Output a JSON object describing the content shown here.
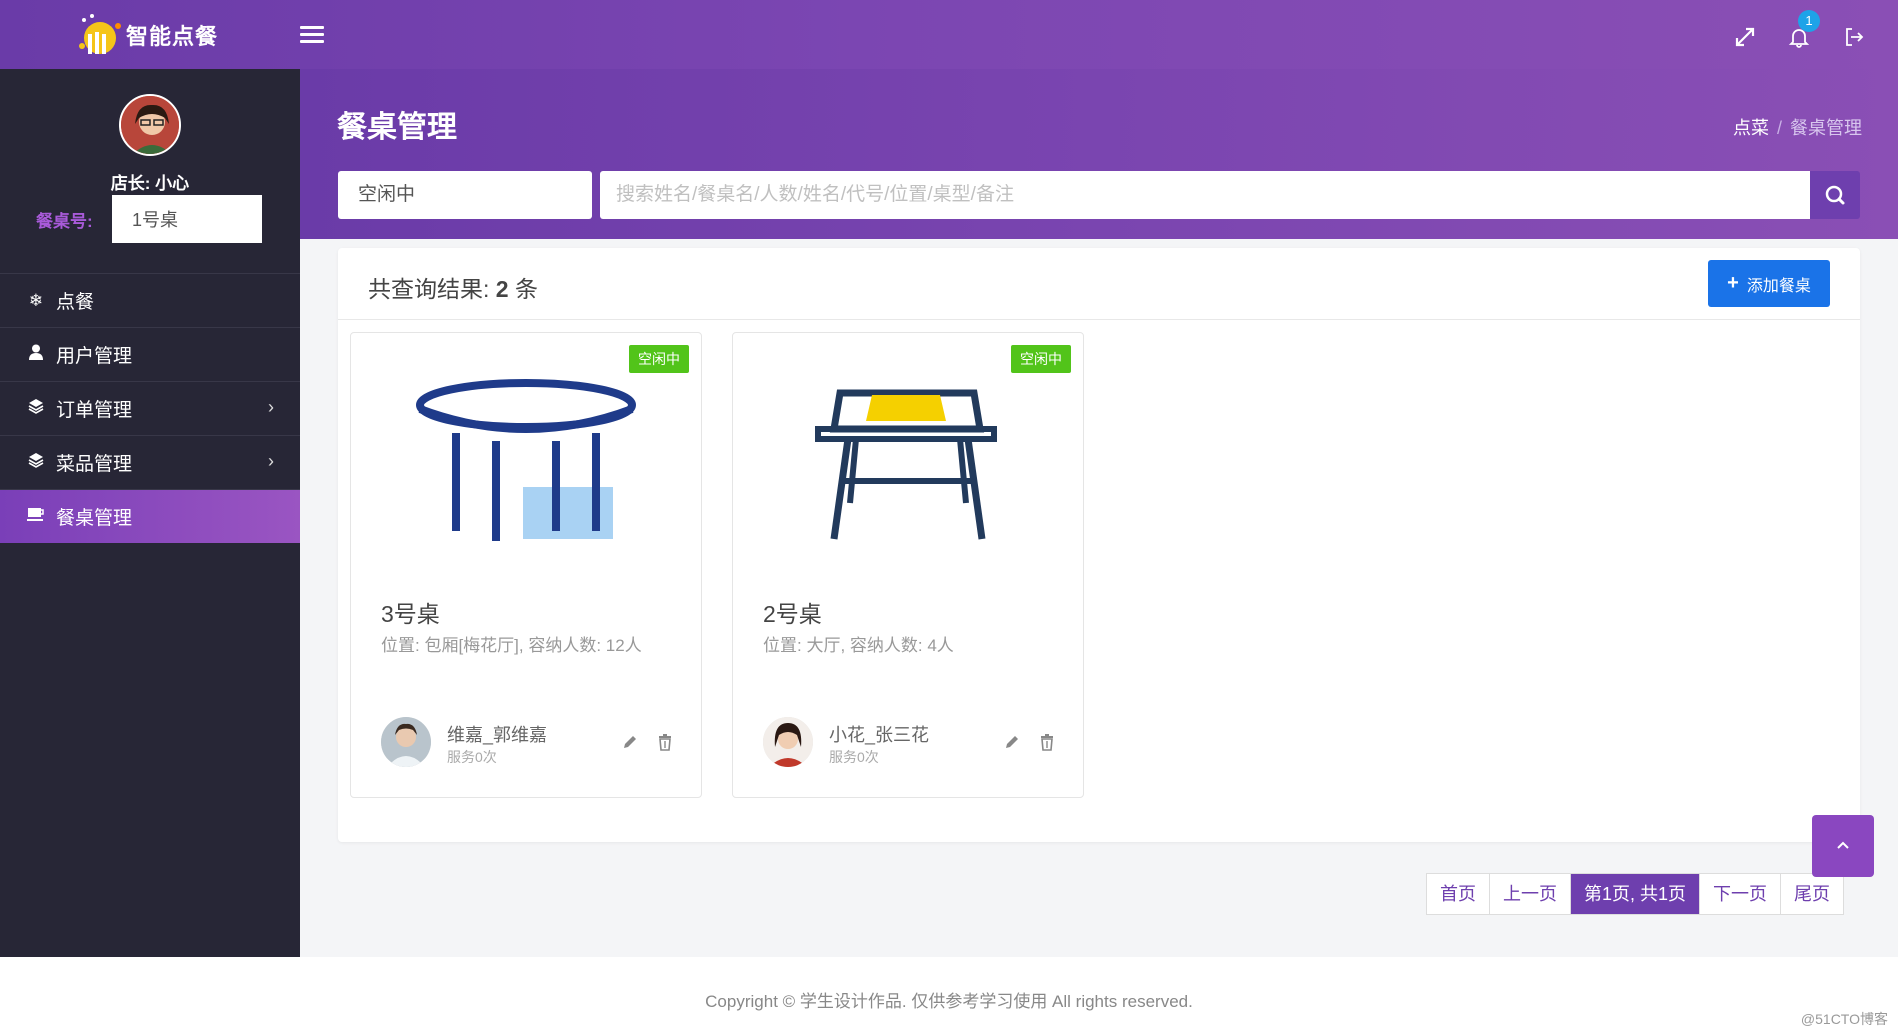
{
  "app": {
    "logo_text": "智能点餐"
  },
  "topbar": {
    "notification_count": "1"
  },
  "sidebar": {
    "owner_label": "店长: 小心",
    "table_no_label": "餐桌号:",
    "table_no_value": "1号桌",
    "items": [
      {
        "label": "点餐",
        "icon": "snowflake-icon",
        "has_submenu": false,
        "active": false
      },
      {
        "label": "用户管理",
        "icon": "user-icon",
        "has_submenu": false,
        "active": false
      },
      {
        "label": "订单管理",
        "icon": "layers-icon",
        "has_submenu": true,
        "active": false
      },
      {
        "label": "菜品管理",
        "icon": "layers-icon",
        "has_submenu": true,
        "active": false
      },
      {
        "label": "餐桌管理",
        "icon": "coffee-icon",
        "has_submenu": false,
        "active": true
      }
    ]
  },
  "header": {
    "title": "餐桌管理",
    "breadcrumb": [
      "点菜",
      "餐桌管理"
    ],
    "breadcrumb_sep": "/"
  },
  "filters": {
    "status_value": "空闲中",
    "search_placeholder": "搜索姓名/餐桌名/人数/姓名/代号/位置/桌型/备注"
  },
  "results": {
    "prefix": "共查询结果:",
    "count": "2",
    "suffix": "条",
    "add_button_label": "添加餐桌"
  },
  "tables": [
    {
      "status": "空闲中",
      "name": "3号桌",
      "description": "位置: 包厢[梅花厅], 容纳人数: 12人",
      "waiter_name": "维嘉_郭维嘉",
      "waiter_served": "服务0次",
      "image": "round-table-illustration"
    },
    {
      "status": "空闲中",
      "name": "2号桌",
      "description": "位置: 大厅, 容纳人数: 4人",
      "waiter_name": "小花_张三花",
      "waiter_served": "服务0次",
      "image": "square-table-illustration"
    }
  ],
  "pagination": {
    "first": "首页",
    "prev": "上一页",
    "current": "第1页, 共1页",
    "next": "下一页",
    "last": "尾页"
  },
  "footer": {
    "copyright": "Copyright © 学生设计作品. 仅供参考学习使用 All rights reserved.",
    "watermark": "@51CTO博客"
  },
  "colors": {
    "primary": "#6e3fae",
    "sidebar_bg": "#272636",
    "status_green": "#52c41a",
    "add_button": "#1a73e8"
  }
}
